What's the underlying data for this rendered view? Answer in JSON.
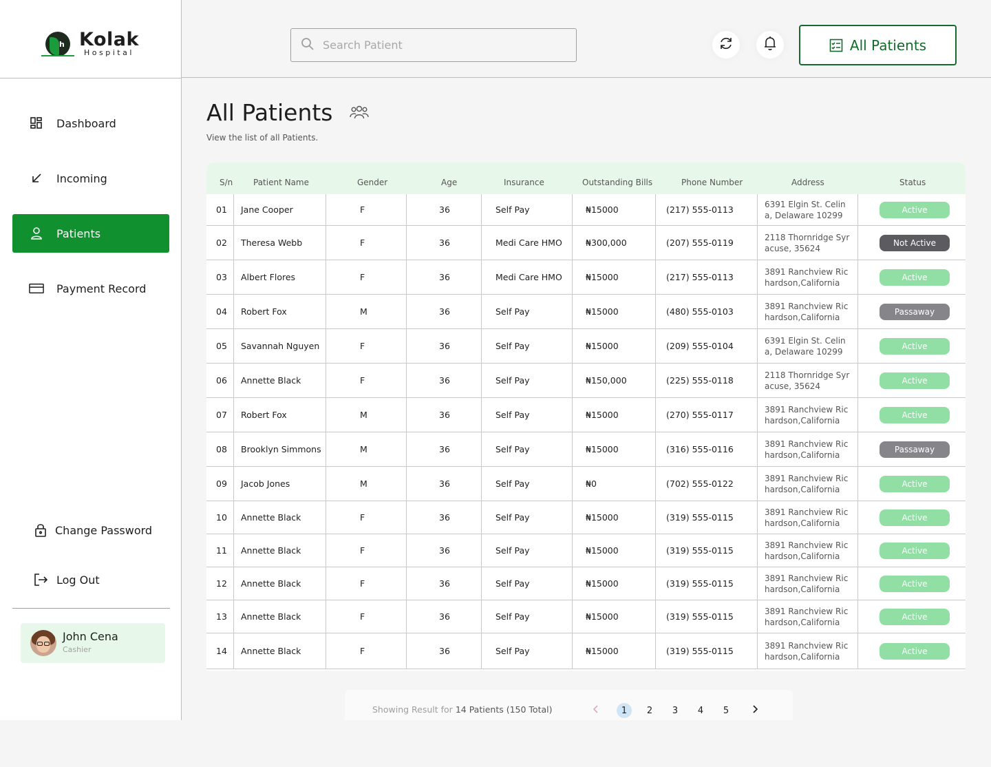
{
  "brand": {
    "name": "Kolak",
    "sub": "Hospital"
  },
  "sidebar": {
    "items": [
      {
        "label": "Dashboard",
        "icon": "dashboard-icon"
      },
      {
        "label": "Incoming",
        "icon": "arrow-down-left-icon"
      },
      {
        "label": "Patients",
        "icon": "user-icon",
        "active": true
      },
      {
        "label": "Payment Record",
        "icon": "credit-card-icon"
      }
    ],
    "bottom": [
      {
        "label": "Change Password",
        "icon": "lock-icon"
      },
      {
        "label": "Log Out",
        "icon": "logout-icon"
      }
    ],
    "user": {
      "name": "John Cena",
      "role": "Cashier"
    }
  },
  "header": {
    "search_placeholder": "Search Patient",
    "all_patients_label": "All Patients"
  },
  "page": {
    "title": "All Patients",
    "subtitle": "View the list of all Patients."
  },
  "table": {
    "columns": [
      "S/n",
      "Patient Name",
      "Gender",
      "Age",
      "Insurance",
      "Outstanding Bills",
      "Phone Number",
      "Address",
      "Status"
    ],
    "rows": [
      {
        "sn": "01",
        "name": "Jane Cooper",
        "gender": "F",
        "age": "36",
        "insurance": "Self Pay",
        "bills": "₦15000",
        "phone": "(217) 555-0113",
        "address": "6391 Elgin St. Celina, Delaware 10299",
        "status": "Active"
      },
      {
        "sn": "02",
        "name": "Theresa Webb",
        "gender": "F",
        "age": "36",
        "insurance": "Medi Care HMO",
        "bills": "₦300,000",
        "phone": "(207) 555-0119",
        "address": "2118 Thornridge Syracuse, 35624",
        "status": "Not Active"
      },
      {
        "sn": "03",
        "name": "Albert Flores",
        "gender": "F",
        "age": "36",
        "insurance": "Medi Care HMO",
        "bills": "₦15000",
        "phone": "(217) 555-0113",
        "address": "3891 Ranchview Richardson,California",
        "status": "Active"
      },
      {
        "sn": "04",
        "name": "Robert Fox",
        "gender": "M",
        "age": "36",
        "insurance": "Self Pay",
        "bills": "₦15000",
        "phone": "(480) 555-0103",
        "address": "3891 Ranchview Richardson,California",
        "status": "Passaway"
      },
      {
        "sn": "05",
        "name": "Savannah Nguyen",
        "gender": "F",
        "age": "36",
        "insurance": "Self Pay",
        "bills": "₦15000",
        "phone": "(209) 555-0104",
        "address": "6391 Elgin St. Celina, Delaware 10299",
        "status": "Active"
      },
      {
        "sn": "06",
        "name": "Annette Black",
        "gender": "F",
        "age": "36",
        "insurance": "Self Pay",
        "bills": "₦150,000",
        "phone": "(225) 555-0118",
        "address": "2118 Thornridge Syracuse, 35624",
        "status": "Active"
      },
      {
        "sn": "07",
        "name": "Robert Fox",
        "gender": "M",
        "age": "36",
        "insurance": "Self Pay",
        "bills": "₦15000",
        "phone": "(270) 555-0117",
        "address": "3891 Ranchview Richardson,California",
        "status": "Active"
      },
      {
        "sn": "08",
        "name": "Brooklyn Simmons",
        "gender": "M",
        "age": "36",
        "insurance": "Self Pay",
        "bills": "₦15000",
        "phone": "(316) 555-0116",
        "address": "3891 Ranchview Richardson,California",
        "status": "Passaway"
      },
      {
        "sn": "09",
        "name": "Jacob Jones",
        "gender": "M",
        "age": "36",
        "insurance": "Self Pay",
        "bills": "₦0",
        "phone": "(702) 555-0122",
        "address": "3891 Ranchview Richardson,California",
        "status": "Active"
      },
      {
        "sn": "10",
        "name": "Annette Black",
        "gender": "F",
        "age": "36",
        "insurance": "Self Pay",
        "bills": "₦15000",
        "phone": "(319) 555-0115",
        "address": "3891 Ranchview Richardson,California",
        "status": "Active"
      },
      {
        "sn": "11",
        "name": "Annette Black",
        "gender": "F",
        "age": "36",
        "insurance": "Self Pay",
        "bills": "₦15000",
        "phone": "(319) 555-0115",
        "address": "3891 Ranchview Richardson,California",
        "status": "Active"
      },
      {
        "sn": "12",
        "name": "Annette Black",
        "gender": "F",
        "age": "36",
        "insurance": "Self Pay",
        "bills": "₦15000",
        "phone": "(319) 555-0115",
        "address": "3891 Ranchview Richardson,California",
        "status": "Active"
      },
      {
        "sn": "13",
        "name": "Annette Black",
        "gender": "F",
        "age": "36",
        "insurance": "Self Pay",
        "bills": "₦15000",
        "phone": "(319) 555-0115",
        "address": "3891 Ranchview Richardson,California",
        "status": "Active"
      },
      {
        "sn": "14",
        "name": "Annette Black",
        "gender": "F",
        "age": "36",
        "insurance": "Self Pay",
        "bills": "₦15000",
        "phone": "(319) 555-0115",
        "address": "3891 Ranchview Richardson,California",
        "status": "Active"
      }
    ]
  },
  "pagination": {
    "prefix": "Showing Result for",
    "count": "14 Patients (150 Total)",
    "pages": [
      "1",
      "2",
      "3",
      "4",
      "5"
    ],
    "current": "1"
  },
  "colors": {
    "primary": "#11902f",
    "header_row": "#e7f8ea",
    "active": "#92dfa6",
    "not_active": "#5b5b60",
    "passaway": "#86868a"
  }
}
